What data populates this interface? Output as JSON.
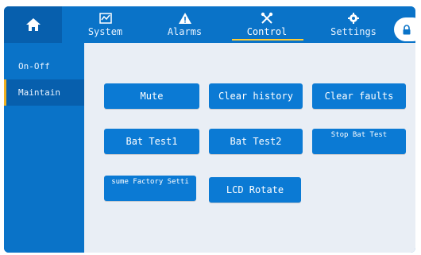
{
  "topbar": {
    "tabs": [
      {
        "label": "System",
        "icon": "chart-icon"
      },
      {
        "label": "Alarms",
        "icon": "warning-icon"
      },
      {
        "label": "Control",
        "icon": "tools-icon"
      },
      {
        "label": "Settings",
        "icon": "gear-icon"
      }
    ],
    "active_tab": "Control",
    "home_icon": "home-icon",
    "lock_icon": "lock-icon"
  },
  "sidebar": {
    "items": [
      {
        "label": "On-Off"
      },
      {
        "label": "Maintain"
      }
    ],
    "selected": "Maintain"
  },
  "buttons": {
    "mute": "Mute",
    "clear_history": "Clear history",
    "clear_faults": "Clear faults",
    "bat_test1": "Bat Test1",
    "bat_test2": "Bat Test2",
    "stop_bat_test": "Stop Bat Test",
    "resume_factory": "sume Factory Setti",
    "lcd_rotate": "LCD Rotate"
  },
  "colors": {
    "frame_blue": "#0a73c8",
    "dark_blue": "#075fad",
    "content_bg": "#e9eef5",
    "accent": "#f0b020"
  }
}
